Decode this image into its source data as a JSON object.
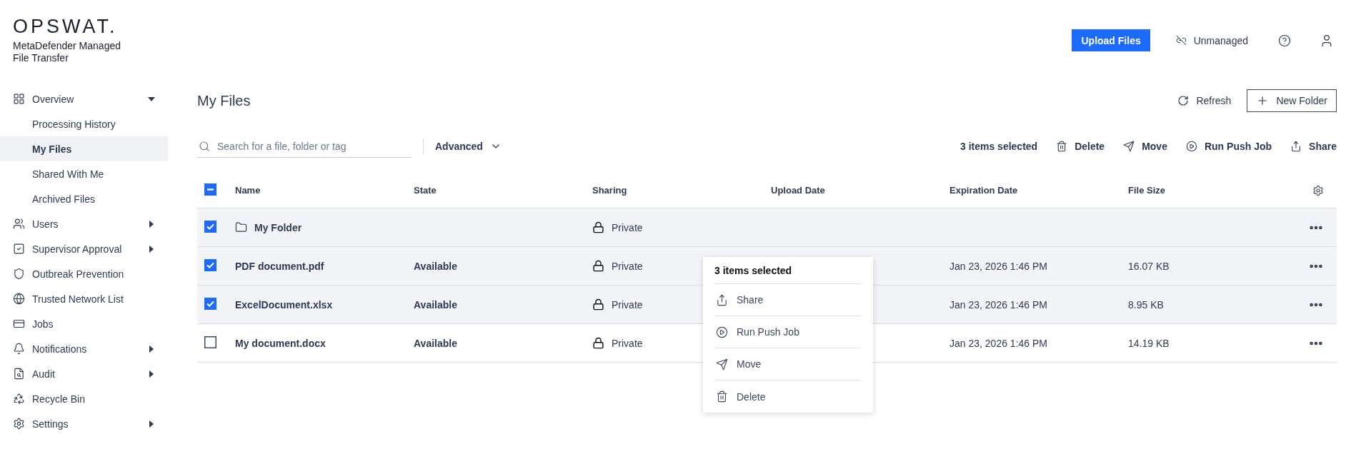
{
  "brand": {
    "logo": "OPSWAT.",
    "product": "MetaDefender Managed File Transfer"
  },
  "sidebar": {
    "items": [
      {
        "label": "Overview",
        "expanded": true,
        "selected": false,
        "children": [
          {
            "label": "Processing History",
            "selected": false
          },
          {
            "label": "My Files",
            "selected": true
          },
          {
            "label": "Shared With Me",
            "selected": false
          },
          {
            "label": "Archived Files",
            "selected": false
          }
        ]
      },
      {
        "label": "Users",
        "expanded": false,
        "selected": false
      },
      {
        "label": "Supervisor Approval",
        "expanded": false,
        "selected": false
      },
      {
        "label": "Outbreak Prevention",
        "selected": false
      },
      {
        "label": "Trusted Network List",
        "selected": false
      },
      {
        "label": "Jobs",
        "selected": false
      },
      {
        "label": "Notifications",
        "expanded": false,
        "selected": false
      },
      {
        "label": "Audit",
        "expanded": false,
        "selected": false
      },
      {
        "label": "Recycle Bin",
        "selected": false
      },
      {
        "label": "Settings",
        "expanded": false,
        "selected": false
      }
    ]
  },
  "header": {
    "upload_button": "Upload Files",
    "status_link": "Unmanaged"
  },
  "page": {
    "title": "My Files",
    "refresh": "Refresh",
    "new_folder": "New Folder"
  },
  "toolbar": {
    "search": {
      "placeholder": "Search for a file, folder or tag"
    },
    "advanced": "Advanced",
    "selection_count": "3 items selected",
    "actions": [
      "Delete",
      "Move",
      "Run Push Job",
      "Share"
    ]
  },
  "table": {
    "select_all": {
      "checked": false,
      "indeterminate": true
    },
    "columns": [
      "Name",
      "State",
      "Sharing",
      "Upload Date",
      "Expiration Date",
      "File Size"
    ],
    "rows": [
      {
        "kind": "folder",
        "name": "My Folder",
        "sharing": "Private",
        "selected": true
      },
      {
        "kind": "file",
        "name": "PDF document.pdf",
        "state": "Available",
        "sharing": "Private",
        "expiration_date": "Jan 23, 2026 1:46 PM",
        "file_size": "16.07 KB",
        "selected": true
      },
      {
        "kind": "file",
        "name": "ExcelDocument.xlsx",
        "state": "Available",
        "sharing": "Private",
        "expiration_date": "Jan 23, 2026 1:46 PM",
        "file_size": "8.95 KB",
        "selected": true
      },
      {
        "kind": "file",
        "name": "My document.docx",
        "state": "Available",
        "sharing": "Private",
        "expiration_date": "Jan 23, 2026 1:46 PM",
        "file_size": "14.19 KB",
        "selected": false
      }
    ]
  },
  "context_menu": {
    "title": "3 items selected",
    "items": [
      "Share",
      "Run Push Job",
      "Move",
      "Delete"
    ]
  }
}
